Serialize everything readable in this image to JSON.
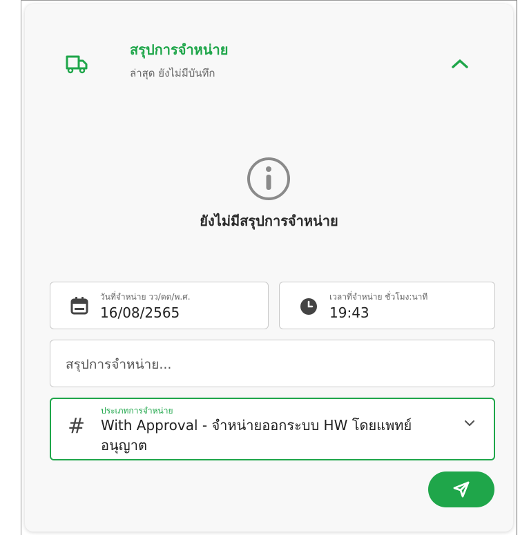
{
  "header": {
    "title": "สรุปการจำหน่าย",
    "subtitle": "ล่าสุด ยังไม่มีบันทึก",
    "icon": "truck-icon",
    "collapse_icon": "chevron-up-icon"
  },
  "empty_state": {
    "icon": "info-icon",
    "message": "ยังไม่มีสรุปการจำหน่าย"
  },
  "date_field": {
    "icon": "calendar-icon",
    "label": "วันที่จำหน่าย วว/ดด/พ.ศ.",
    "value": "16/08/2565"
  },
  "time_field": {
    "icon": "clock-icon",
    "label": "เวลาที่จำหน่าย ชั่วโมง:นาที",
    "value": "19:43"
  },
  "summary_field": {
    "placeholder": "สรุปการจำหน่าย..."
  },
  "type_field": {
    "icon": "hash-icon",
    "label": "ประเภทการจำหน่าย",
    "value": "With Approval - จำหน่ายออกระบบ HW โดยแพทย์อนุญาต",
    "dropdown_icon": "chevron-down-icon"
  },
  "send_button": {
    "icon": "send-icon"
  },
  "colors": {
    "accent": "#1fa64a",
    "text": "#222222",
    "muted": "#666666",
    "border": "#c9c9c9"
  }
}
